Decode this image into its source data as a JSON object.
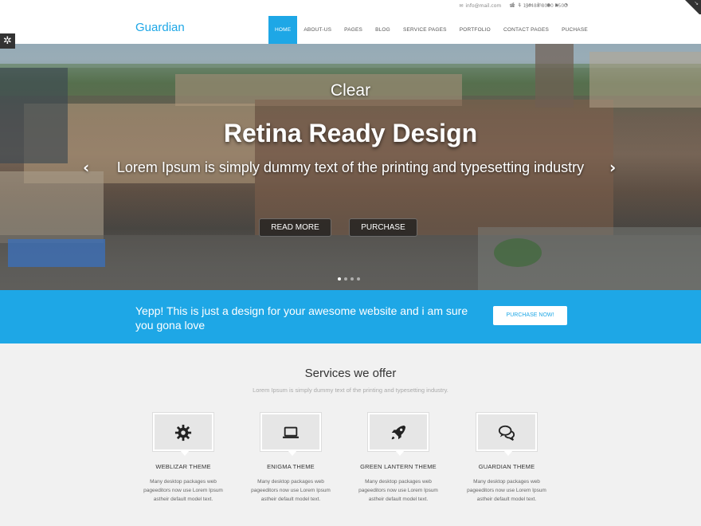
{
  "topbar": {
    "email": "info@mail.com",
    "phone": "+ 1 4488 8000 4500",
    "social_icons": [
      "facebook-icon",
      "twitter-icon",
      "google-plus-icon",
      "linkedin-icon",
      "dribbble-icon",
      "youtube-icon",
      "rss-icon"
    ]
  },
  "header": {
    "logo": "Guardian",
    "nav": [
      "HOME",
      "ABOUT-US",
      "PAGES",
      "BLOG",
      "SERVICE PAGES",
      "PORTFOLIO",
      "CONTACT PAGES",
      "PUCHASE"
    ],
    "active_nav": "HOME",
    "accent": "#1ea7e6"
  },
  "hero": {
    "clear": "Clear",
    "title": "Retina Ready Design",
    "subtitle": "Lorem Ipsum is simply dummy text of the printing and typesetting industry",
    "read_more": "READ MORE",
    "purchase": "PURCHASE",
    "slides": 4,
    "active_slide": 1
  },
  "callout": {
    "text": "Yepp! This is just a design for your awesome website and i am sure you gona love",
    "button": "PURCHASE NOW!"
  },
  "services": {
    "title": "Services we offer",
    "subtitle": "Lorem Ipsum is simply dummy text of the printing and typesetting industry.",
    "items": [
      {
        "name": "WEBLIZAR THEME",
        "icon": "gear-icon",
        "desc": "Many desktop packages web pageeditors now use Lorem Ipsum astheir default model text."
      },
      {
        "name": "ENIGMA THEME",
        "icon": "laptop-icon",
        "desc": "Many desktop packages web pageeditors now use Lorem Ipsum astheir default model text."
      },
      {
        "name": "GREEN LANTERN THEME",
        "icon": "rocket-icon",
        "desc": "Many desktop packages web pageeditors now use Lorem Ipsum astheir default model text."
      },
      {
        "name": "GUARDIAN THEME",
        "icon": "comments-icon",
        "desc": "Many desktop packages web pageeditors now use Lorem Ipsum astheir default model text."
      }
    ]
  }
}
